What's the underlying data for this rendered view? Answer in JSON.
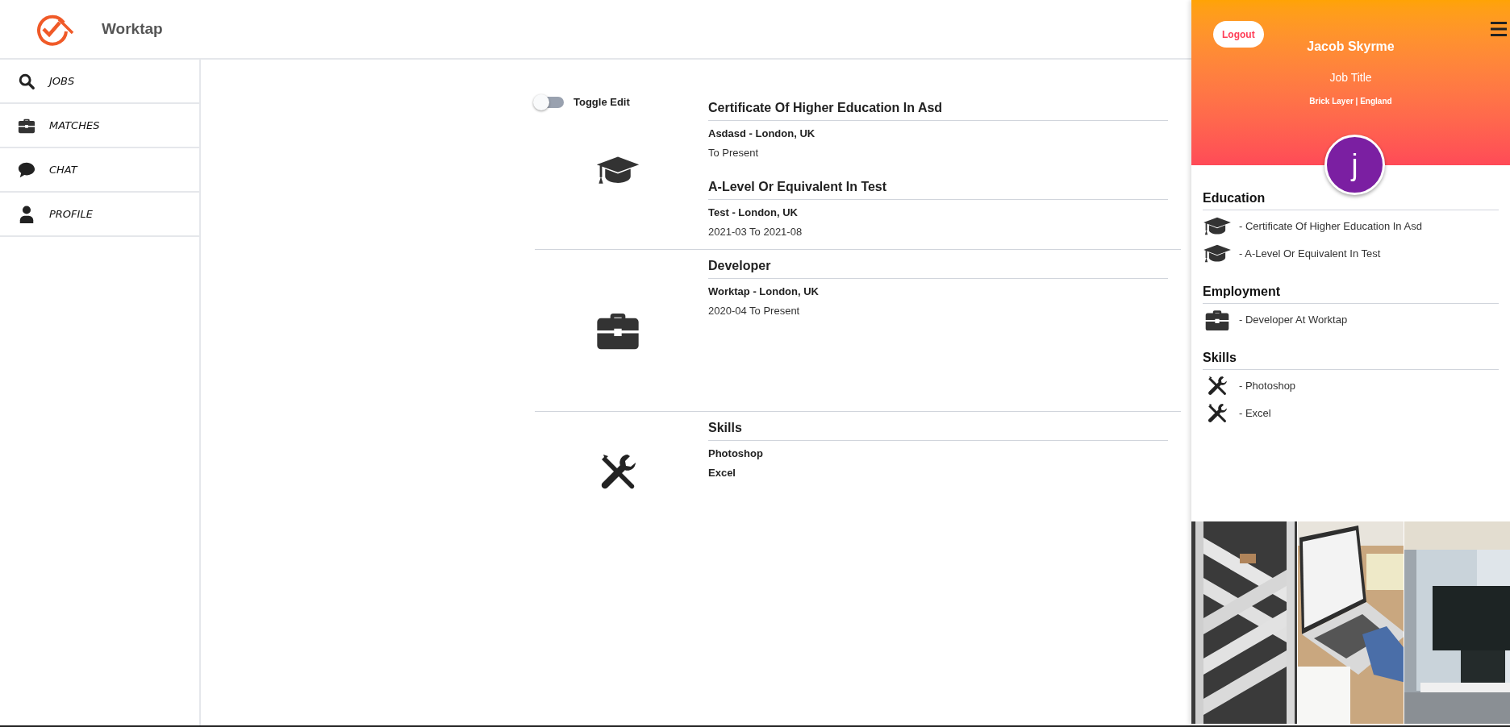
{
  "header": {
    "brand": "Worktap"
  },
  "nav": [
    {
      "label": "JOBS",
      "kind": "search",
      "selected": false
    },
    {
      "label": "MATCHES",
      "kind": "briefcase",
      "selected": false
    },
    {
      "label": "CHAT",
      "kind": "chat",
      "selected": false
    },
    {
      "label": "PROFILE",
      "kind": "user",
      "selected": false
    }
  ],
  "toggle": {
    "label": "Toggle Edit",
    "on": false
  },
  "sections": [
    {
      "kind": "cap",
      "entries": [
        {
          "title": "Certificate Of Higher Education In Asd",
          "subtitle": "Asdasd - London, UK",
          "dates": "To Present"
        },
        {
          "title": "A-Level Or Equivalent In Test",
          "subtitle": "Test - London, UK",
          "dates": "2021-03 To 2021-08"
        }
      ]
    },
    {
      "kind": "briefcase",
      "entries": [
        {
          "title": "Developer",
          "subtitle": "Worktap - London, UK",
          "dates": "2020-04 To Present"
        }
      ]
    },
    {
      "kind": "tools",
      "entries": [
        {
          "title": "Skills",
          "lines": [
            "Photoshop",
            "Excel"
          ]
        }
      ]
    }
  ],
  "profile": {
    "logout": "Logout",
    "name": "Jacob Skyrme",
    "job_title": "Job Title",
    "location": "Brick Layer | England",
    "avatar_letter": "j",
    "groups": [
      {
        "title": "Education",
        "kind": "cap",
        "items": [
          "- Certificate Of Higher Education In Asd",
          "- A-Level Or Equivalent In Test"
        ]
      },
      {
        "title": "Employment",
        "kind": "briefcase",
        "items": [
          "- Developer At Worktap"
        ]
      },
      {
        "title": "Skills",
        "kind": "tools",
        "items": [
          "- Photoshop",
          "- Excel"
        ]
      }
    ]
  }
}
